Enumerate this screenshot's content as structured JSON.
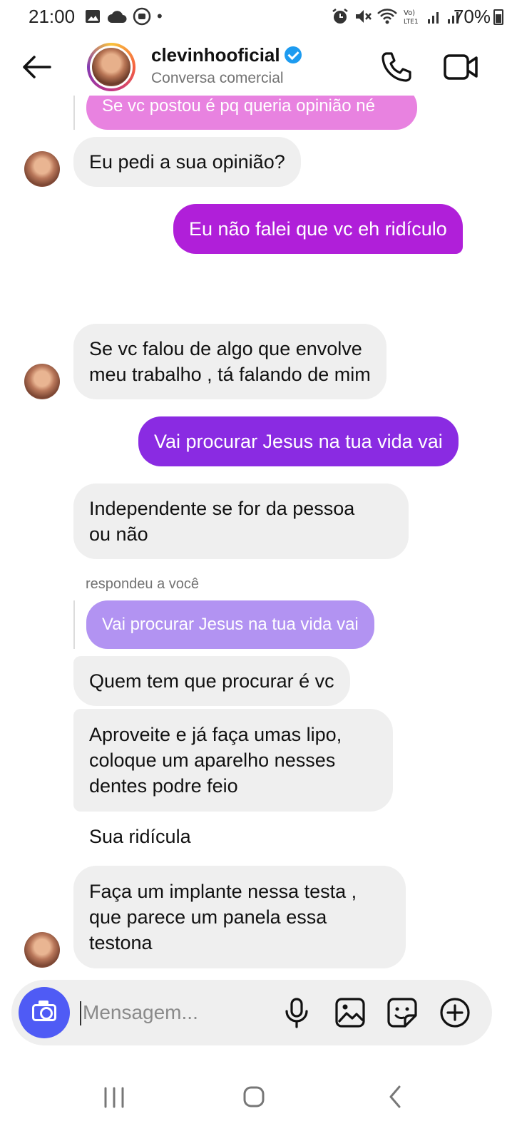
{
  "status_bar": {
    "time": "21:00",
    "battery": "70%",
    "dot": "•"
  },
  "header": {
    "contact_name": "clevinhooficial",
    "subtitle": "Conversa comercial",
    "back_icon": "arrow-left-icon",
    "call_icon": "phone-icon",
    "video_icon": "video-camera-icon"
  },
  "messages": {
    "m0_partial": "Se vc postou é pq queria opinião né",
    "m1": "Eu pedi a sua opinião?",
    "m2": "Eu não falei que vc eh ridículo",
    "m3_line1": "Se vc falou de algo que envolve",
    "m3_line2": "meu trabalho , tá falando de mim",
    "m4": "Vai procurar Jesus na tua vida vai",
    "m5_line1": "Independente se for da pessoa",
    "m5_line2": "ou não",
    "reply_label": "respondeu a você",
    "reply_quote": "Vai procurar Jesus na tua vida vai",
    "m6": "Quem tem que procurar é vc",
    "m7_line1": "Aproveite e já faça umas lipo,",
    "m7_line2": "coloque um aparelho nesses",
    "m7_line3": "dentes podre feio",
    "m8": "Sua ridícula",
    "m9_line1": "Faça um implante nessa testa ,",
    "m9_line2": "que parece um panela essa",
    "m9_line3": "testona"
  },
  "composer": {
    "placeholder": "Mensagem...",
    "icons": [
      "camera-icon",
      "microphone-icon",
      "gallery-icon",
      "sticker-icon",
      "plus-circle-icon"
    ]
  },
  "colors": {
    "bubble_in": "#efefef",
    "bubble_out_1": "#b01fd9",
    "bubble_out_2": "#8a2be2",
    "reply_quote_pink": "#e882e0",
    "reply_quote_purple": "#b293f2",
    "camera_button": "#4f5bf5",
    "verified": "#1d9bf0"
  }
}
